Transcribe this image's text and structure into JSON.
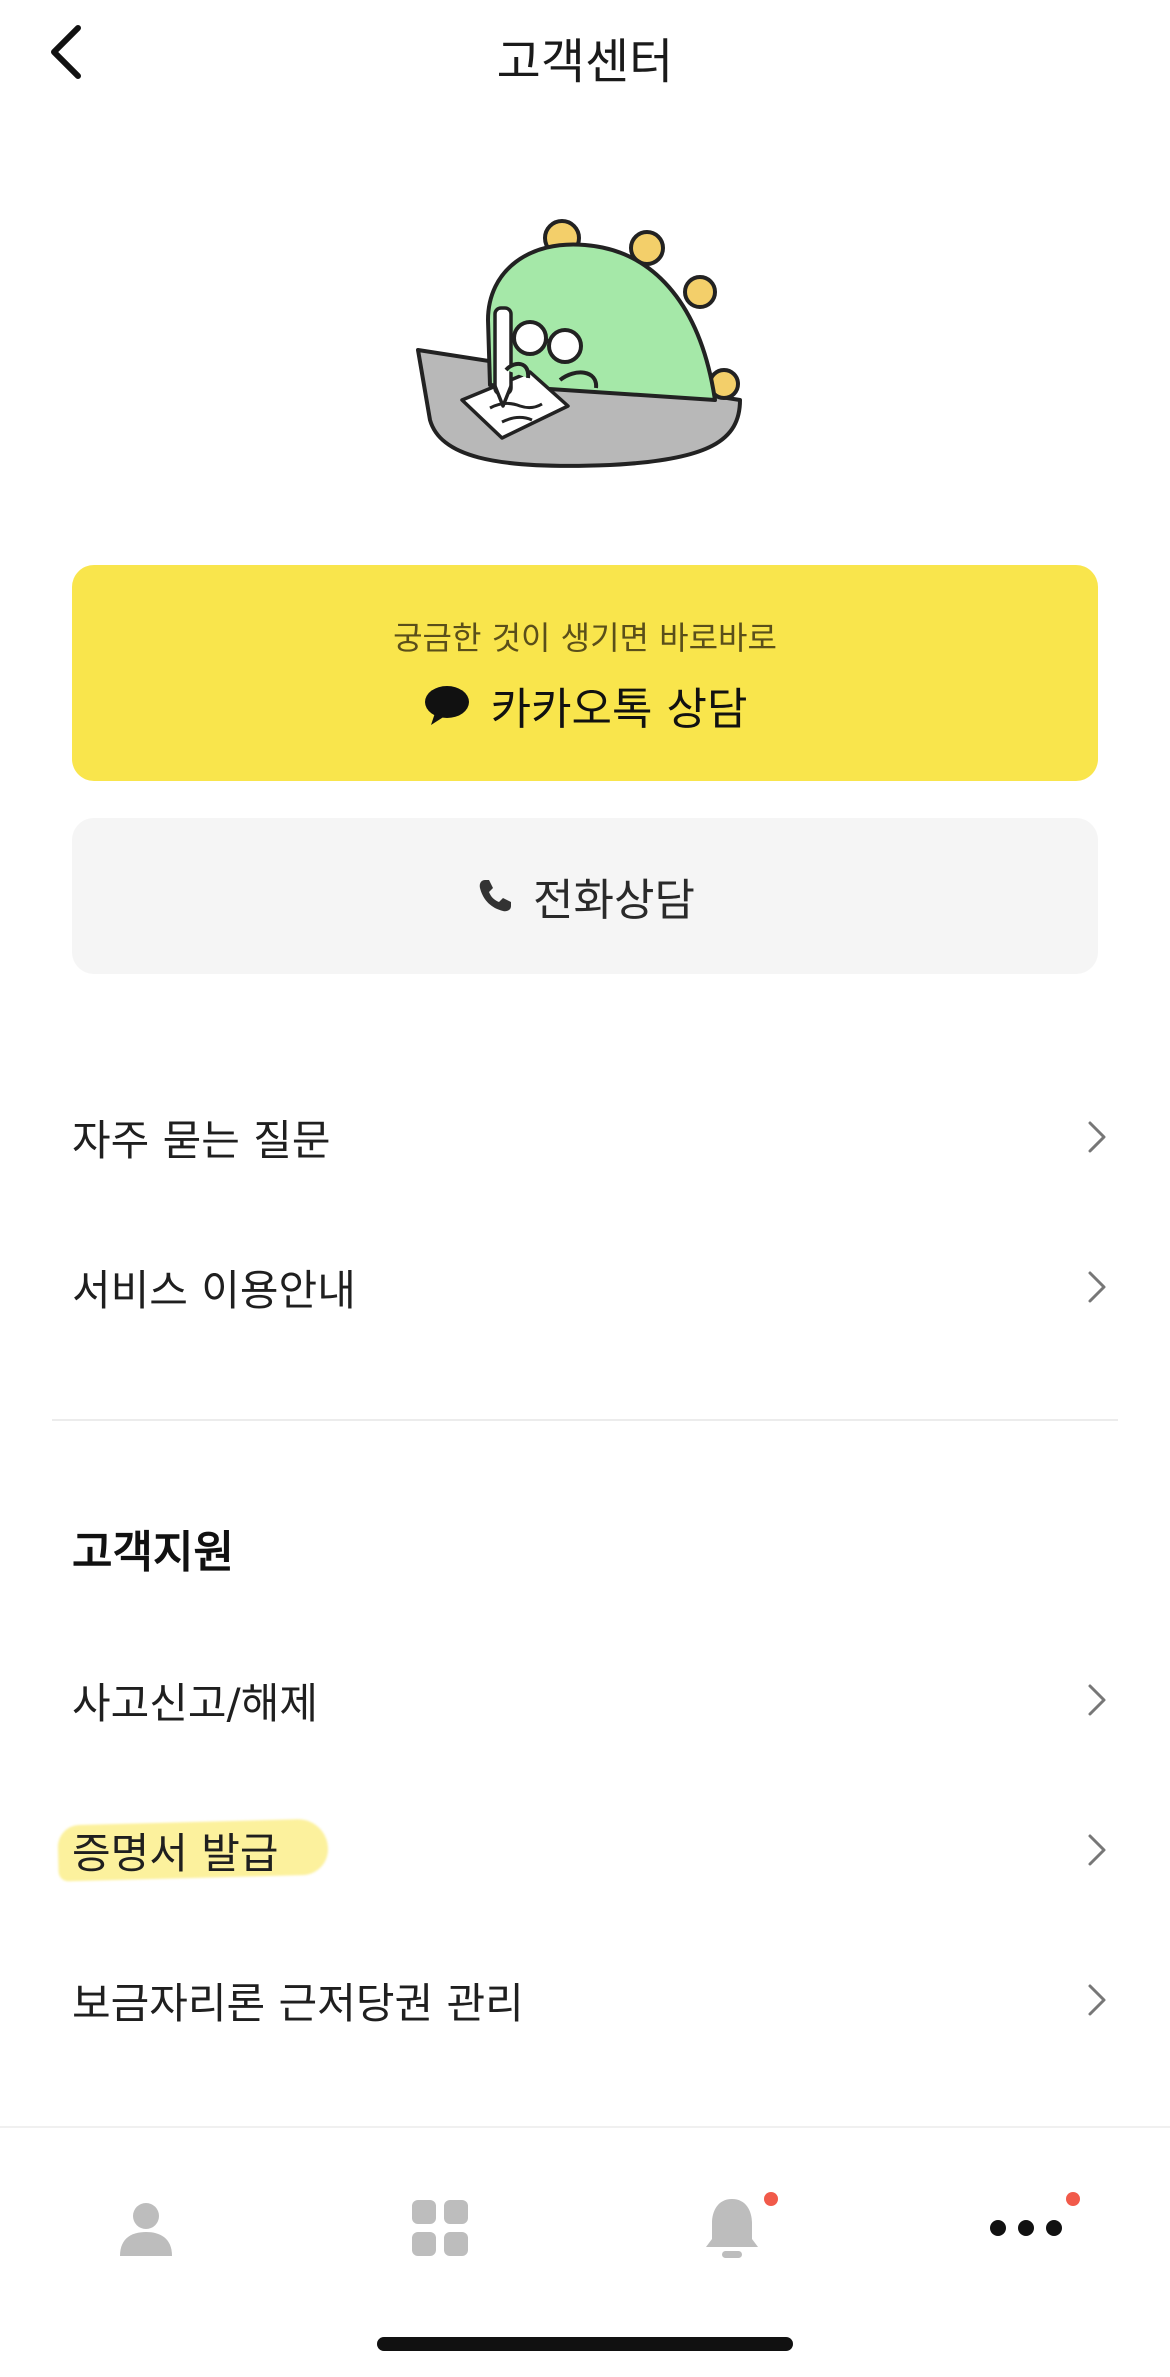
{
  "header": {
    "title": "고객센터",
    "back_icon": "chevron-left-icon"
  },
  "kakao_consult": {
    "subtitle": "궁금한 것이 생기면 바로바로",
    "label": "카카오톡 상담",
    "icon": "chat-bubble-icon",
    "color": "#F9E54C"
  },
  "phone_consult": {
    "label": "전화상담",
    "icon": "phone-icon"
  },
  "menu": {
    "items": [
      {
        "label": "자주 묻는 질문"
      },
      {
        "label": "서비스 이용안내"
      }
    ]
  },
  "support": {
    "title": "고객지원",
    "items": [
      {
        "label": "사고신고/해제"
      },
      {
        "label": "증명서 발급",
        "highlighted": true
      },
      {
        "label": "보금자리론 근저당권 관리"
      }
    ]
  },
  "bottom_nav": {
    "items": [
      {
        "icon": "person-icon",
        "badge": false
      },
      {
        "icon": "grid-icon",
        "badge": false
      },
      {
        "icon": "bell-icon",
        "badge": true
      },
      {
        "icon": "more-icon",
        "badge": true
      }
    ],
    "badge_color": "#F15A4A"
  }
}
